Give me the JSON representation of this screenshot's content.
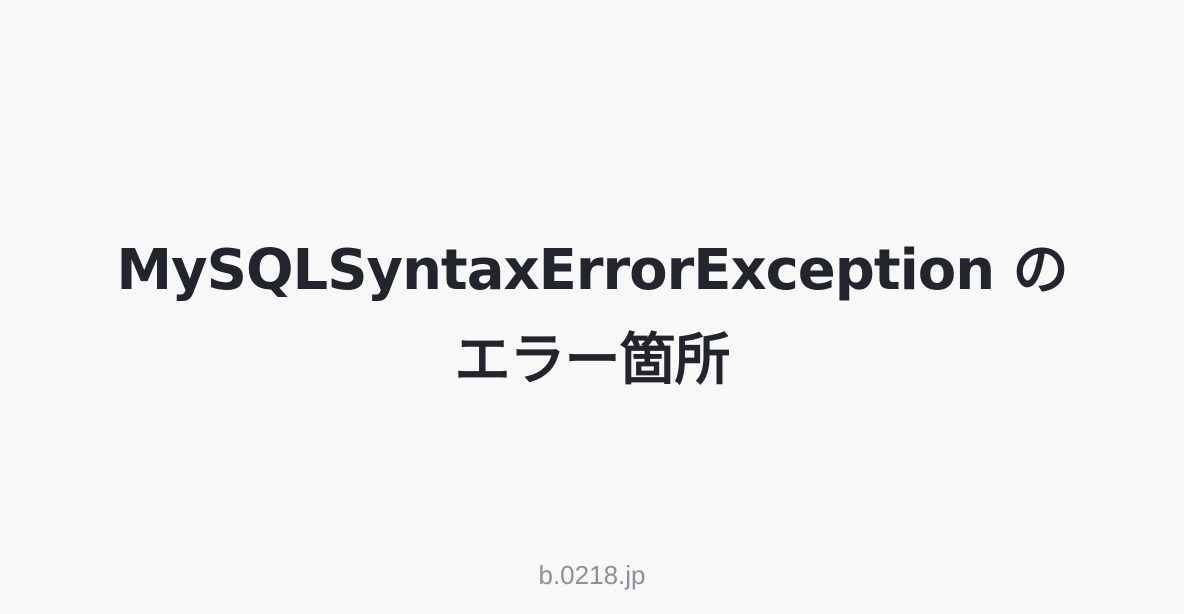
{
  "title": {
    "line1": "MySQLSyntaxErrorException の",
    "line2": "エラー箇所"
  },
  "footer": {
    "site": "b.0218.jp"
  },
  "colors": {
    "background": "#f8f8f9",
    "title_text": "#22252c",
    "footer_text": "#8b9199"
  }
}
